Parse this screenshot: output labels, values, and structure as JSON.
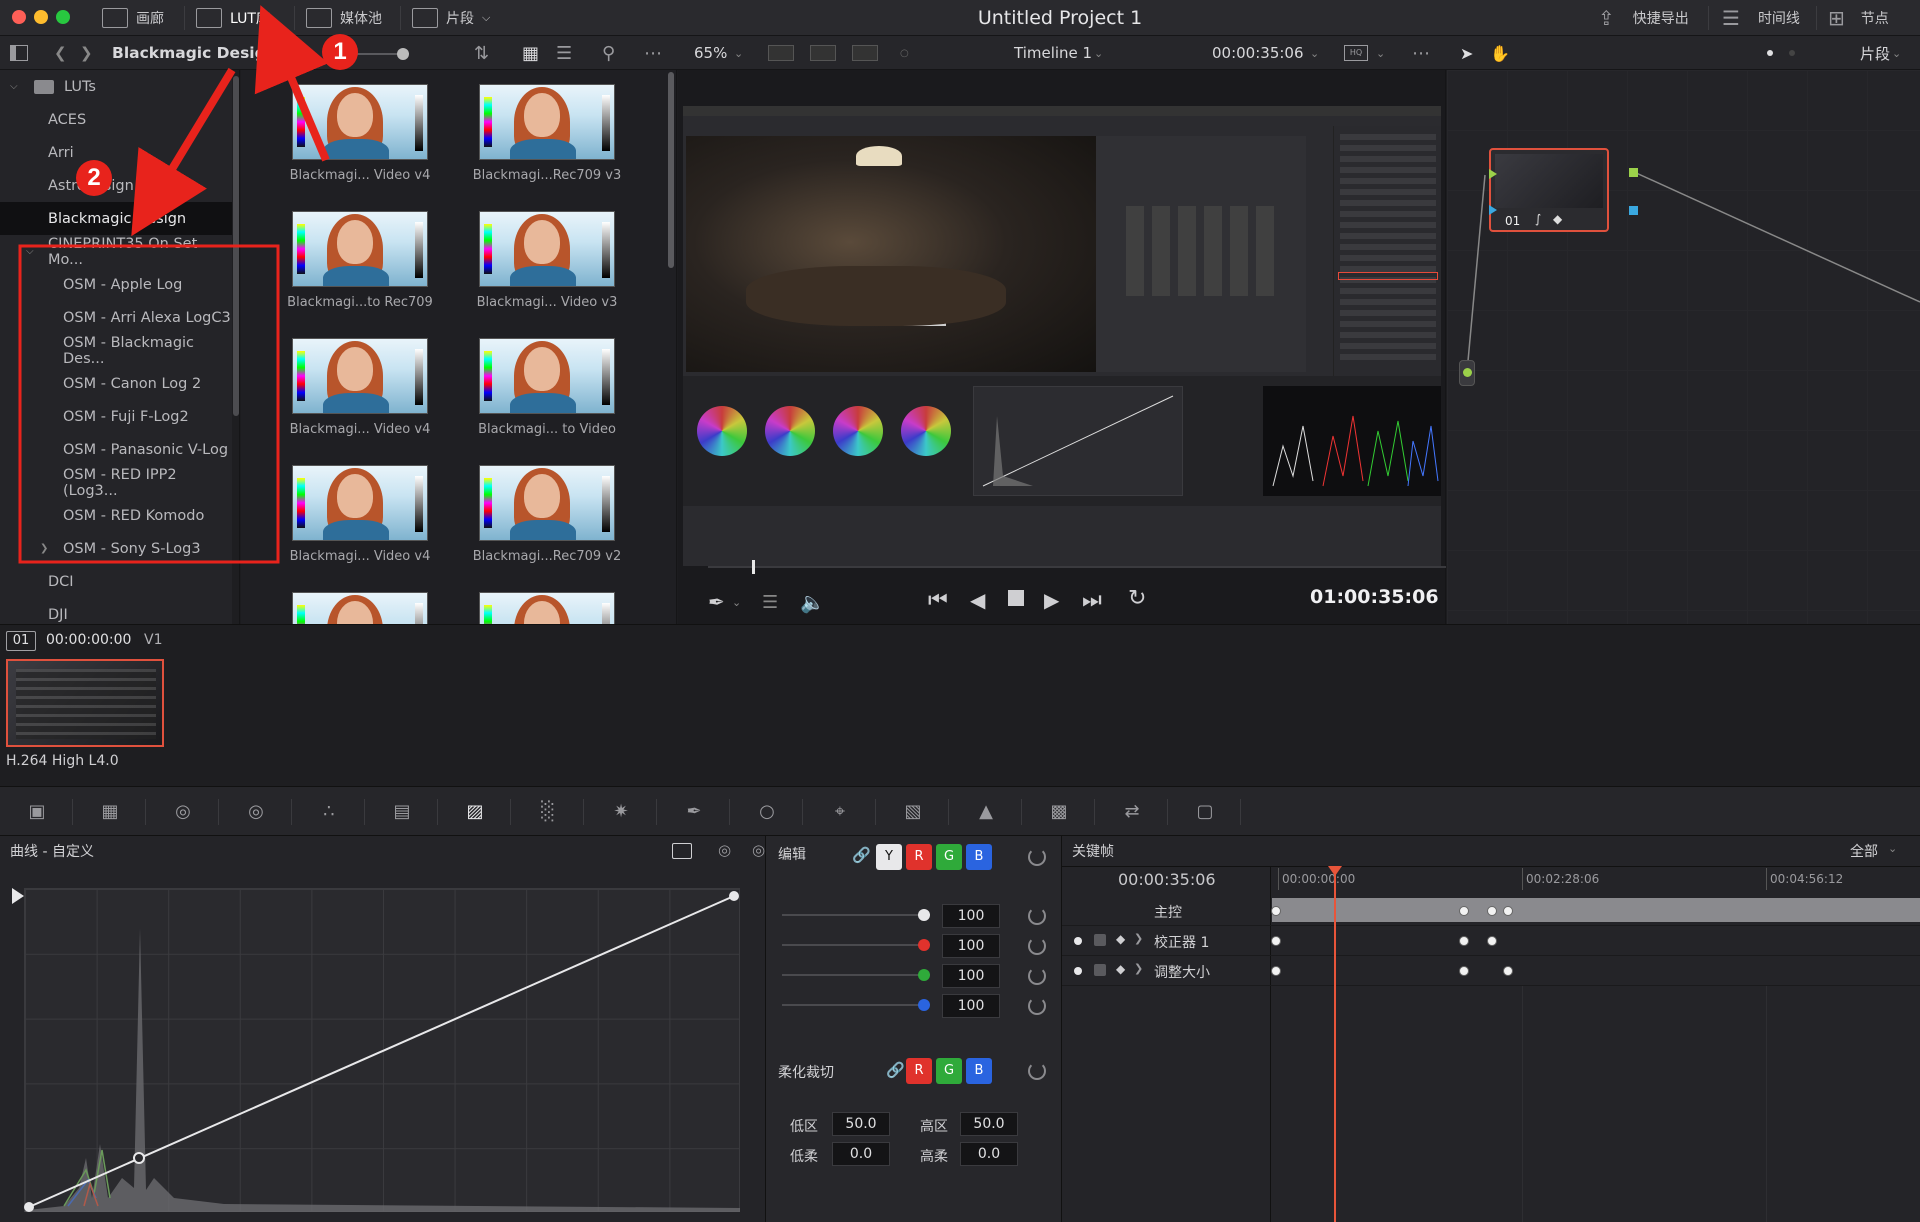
{
  "titlebar": {
    "project_title": "Untitled Project 1",
    "tabs": [
      {
        "label": "画廊",
        "icon": "gallery-icon"
      },
      {
        "label": "LUT库",
        "icon": "lut-library-icon"
      },
      {
        "label": "媒体池",
        "icon": "media-pool-icon"
      },
      {
        "label": "片段",
        "icon": "clips-icon"
      }
    ],
    "right_buttons": [
      {
        "label": "快捷导出",
        "icon": "quick-export-icon"
      },
      {
        "label": "时间线",
        "icon": "timeline-icon"
      },
      {
        "label": "节点",
        "icon": "nodes-icon"
      }
    ]
  },
  "toolbar": {
    "breadcrumb": "Blackmagic Design",
    "zoom": "65%",
    "timeline_name": "Timeline 1",
    "timecode": "00:00:35:06",
    "clip_mode": "片段"
  },
  "lut_tree": {
    "root": "LUTs",
    "items": [
      {
        "label": "ACES",
        "level": 1
      },
      {
        "label": "Arri",
        "level": 1
      },
      {
        "label": "Astrodesign",
        "level": 1
      },
      {
        "label": "Blackmagic Design",
        "level": 1,
        "selected": true
      },
      {
        "label": "CINEPRINT35 On Set Mo...",
        "level": 1,
        "expanded": true
      },
      {
        "label": "OSM - Apple Log",
        "level": 2
      },
      {
        "label": "OSM - Arri Alexa LogC3",
        "level": 2
      },
      {
        "label": "OSM - Blackmagic Des...",
        "level": 2
      },
      {
        "label": "OSM - Canon Log 2",
        "level": 2
      },
      {
        "label": "OSM - Fuji F-Log2",
        "level": 2
      },
      {
        "label": "OSM - Panasonic V-Log",
        "level": 2
      },
      {
        "label": "OSM - RED IPP2 (Log3...",
        "level": 2
      },
      {
        "label": "OSM - RED Komodo",
        "level": 2
      },
      {
        "label": "OSM - Sony S-Log3",
        "level": 2,
        "collapsed": true
      },
      {
        "label": "DCI",
        "level": 1
      },
      {
        "label": "DJI",
        "level": 1
      }
    ]
  },
  "lut_thumbs": [
    "Blackmagi... Video v4",
    "Blackmagi...Rec709 v3",
    "Blackmagi...to Rec709",
    "Blackmagi... Video v3",
    "Blackmagi... Video v4",
    "Blackmagi... to Video",
    "Blackmagi... Video v4",
    "Blackmagi...Rec709 v2"
  ],
  "viewer": {
    "timecode": "01:00:35:06"
  },
  "node": {
    "label": "01"
  },
  "clip": {
    "number": "01",
    "timecode": "00:00:00:00",
    "track": "V1",
    "codec": "H.264 High L4.0"
  },
  "curves": {
    "title": "曲线 - 自定义"
  },
  "edit": {
    "title": "编辑",
    "channels": [
      "Y",
      "R",
      "G",
      "B"
    ],
    "values": [
      "100",
      "100",
      "100",
      "100"
    ],
    "soft_clip_title": "柔化裁切",
    "soft_channels": [
      "R",
      "G",
      "B"
    ],
    "low_label": "低区",
    "low_value": "50.0",
    "high_label": "高区",
    "high_value": "50.0",
    "low_soft_label": "低柔",
    "low_soft_value": "0.0",
    "high_soft_label": "高柔",
    "high_soft_value": "0.0"
  },
  "keyframes": {
    "title": "关键帧",
    "filter": "全部",
    "timecode": "00:00:35:06",
    "ruler": [
      "00:00:00:00",
      "00:02:28:06",
      "00:04:56:12"
    ],
    "rows": [
      "主控",
      "校正器 1",
      "调整大小"
    ]
  },
  "annotations": [
    "1",
    "2"
  ],
  "colors": {
    "accent_red": "#e8231c",
    "playhead": "#e8553a",
    "channel_r": "#e0322c",
    "channel_g": "#2faa3a",
    "channel_b": "#2a64e0"
  }
}
